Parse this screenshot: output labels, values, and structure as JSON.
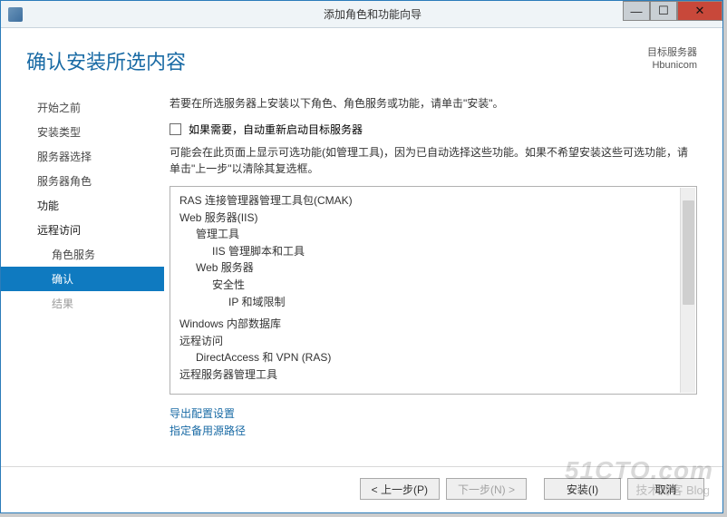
{
  "window": {
    "title": "添加角色和功能向导"
  },
  "header": {
    "page_title": "确认安装所选内容",
    "target_label": "目标服务器",
    "target_value": "Hbunicom"
  },
  "sidebar": {
    "items": [
      {
        "label": "开始之前",
        "selected": false,
        "sub": false,
        "disabled": false
      },
      {
        "label": "安装类型",
        "selected": false,
        "sub": false,
        "disabled": false
      },
      {
        "label": "服务器选择",
        "selected": false,
        "sub": false,
        "disabled": false
      },
      {
        "label": "服务器角色",
        "selected": false,
        "sub": false,
        "disabled": false
      },
      {
        "label": "功能",
        "selected": false,
        "sub": false,
        "disabled": false
      },
      {
        "label": "远程访问",
        "selected": false,
        "sub": false,
        "disabled": false
      },
      {
        "label": "角色服务",
        "selected": false,
        "sub": true,
        "disabled": false
      },
      {
        "label": "确认",
        "selected": true,
        "sub": true,
        "disabled": false
      },
      {
        "label": "结果",
        "selected": false,
        "sub": true,
        "disabled": true
      }
    ]
  },
  "main": {
    "intro": "若要在所选服务器上安装以下角色、角色服务或功能，请单击\"安装\"。",
    "checkbox_label": "如果需要，自动重新启动目标服务器",
    "note": "可能会在此页面上显示可选功能(如管理工具)，因为已自动选择这些功能。如果不希望安装这些可选功能，请单击\"上一步\"以清除其复选框。",
    "tree": [
      {
        "text": "RAS 连接管理器管理工具包(CMAK)",
        "indent": 0
      },
      {
        "text": "Web 服务器(IIS)",
        "indent": 0
      },
      {
        "text": "管理工具",
        "indent": 1
      },
      {
        "text": "IIS 管理脚本和工具",
        "indent": 2
      },
      {
        "text": "Web 服务器",
        "indent": 1
      },
      {
        "text": "安全性",
        "indent": 2
      },
      {
        "text": "IP 和域限制",
        "indent": 3
      },
      {
        "text": "Windows 内部数据库",
        "indent": 0
      },
      {
        "text": "远程访问",
        "indent": 0
      },
      {
        "text": "DirectAccess 和 VPN (RAS)",
        "indent": 1
      },
      {
        "text": "远程服务器管理工具",
        "indent": 0
      }
    ],
    "links": {
      "export": "导出配置设置",
      "alt_source": "指定备用源路径"
    }
  },
  "footer": {
    "prev": "< 上一步(P)",
    "next": "下一步(N) >",
    "install": "安装(I)",
    "cancel": "取消"
  },
  "watermark": {
    "main": "51CTO.com",
    "sub": "技术博客 Blog"
  }
}
